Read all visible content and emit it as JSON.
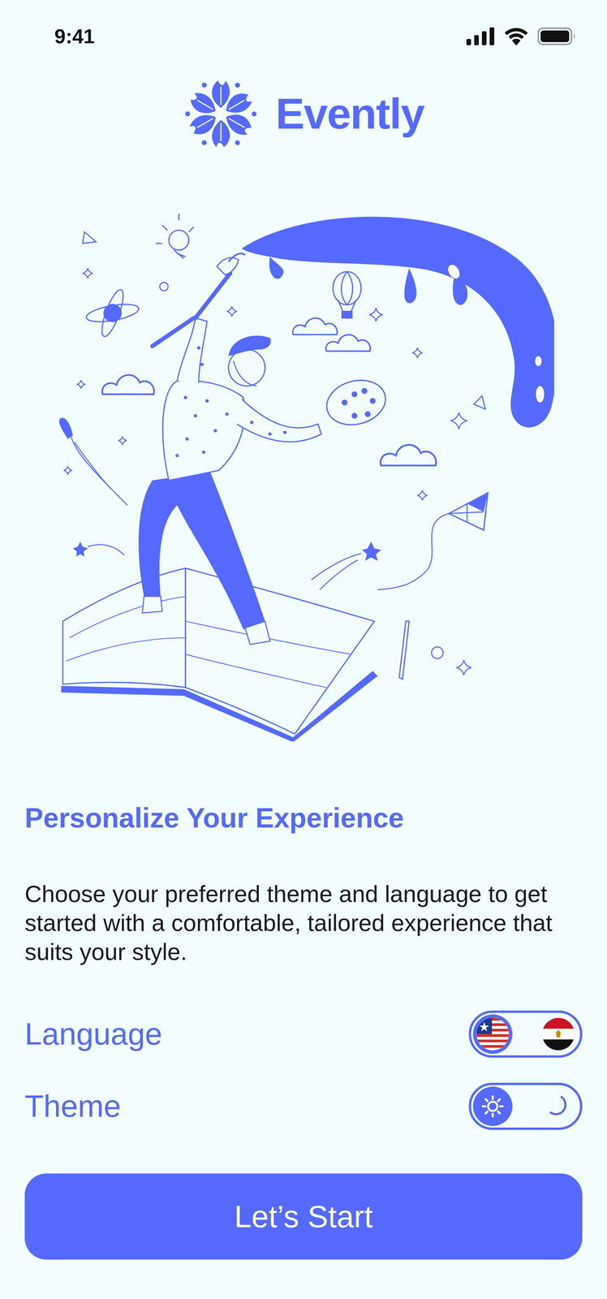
{
  "statusBar": {
    "time": "9:41"
  },
  "brand": {
    "name": "Evently"
  },
  "heading": "Personalize Your Experience",
  "description": "Choose your preferred theme and language to get started with a comfortable, tailored experience that suits your style.",
  "settings": [
    {
      "label": "Language",
      "options": [
        {
          "kind": "us-flag",
          "selected": true
        },
        {
          "kind": "egypt-flag",
          "selected": false
        }
      ]
    },
    {
      "label": "Theme",
      "options": [
        {
          "kind": "sun",
          "selected": true
        },
        {
          "kind": "moon",
          "selected": false
        }
      ]
    }
  ],
  "primaryButton": "Let’s Start"
}
